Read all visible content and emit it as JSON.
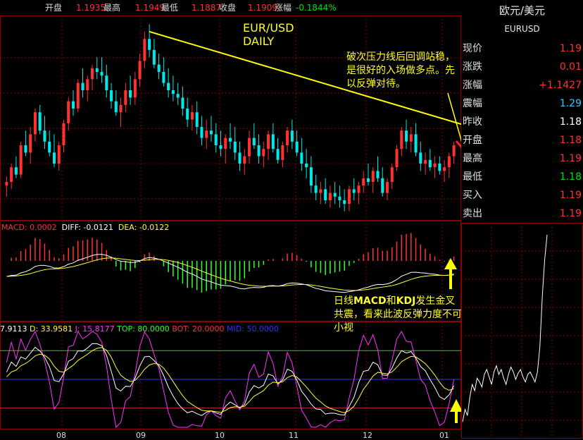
{
  "header": {
    "open_label": "开盘",
    "open_value": "1.1935",
    "high_label": "最高",
    "high_value": "1.1949",
    "low_label": "最低",
    "low_value": "1.1887",
    "close_label": "收盘",
    "close_value": "1.1909",
    "change_label": "涨幅",
    "change_value": "-0.1844%"
  },
  "instrument": {
    "name_cn": "欧元/美元",
    "code": "EURUSD"
  },
  "stats": [
    {
      "label": "现价",
      "value": "1.19",
      "color": "#ff3232"
    },
    {
      "label": "涨跌",
      "value": "0.01",
      "color": "#ff3232"
    },
    {
      "label": "涨幅",
      "value": "+1.1427",
      "color": "#ff3232"
    },
    {
      "label": "震幅",
      "value": "1.29",
      "color": "#32c8ff"
    },
    {
      "label": "昨收",
      "value": "1.18",
      "color": "#ffffff"
    },
    {
      "label": "开盘",
      "value": "1.18",
      "color": "#ff3232"
    },
    {
      "label": "最高",
      "value": "1.19",
      "color": "#ff3232"
    },
    {
      "label": "最低",
      "value": "1.18",
      "color": "#00e000"
    },
    {
      "label": "买入",
      "value": "1.19",
      "color": "#ff3232"
    },
    {
      "label": "卖出",
      "value": "1.19",
      "color": "#ff3232"
    }
  ],
  "annotations": {
    "chart_title_line1": "EUR/USD",
    "chart_title_line2": "DAILY",
    "resistance_note": "破次压力线后回调站稳，是很好的入场做多点。先以反弹对待。",
    "indicator_note_prefix": "日线",
    "indicator_note_macd": "MACD",
    "indicator_note_and": "和",
    "indicator_note_kdj": "KDJ",
    "indicator_note_suffix": "发生金叉共震，看来此波反弹力度不可小视"
  },
  "macd_label": {
    "macd": "MACD: 0.0002",
    "diff": "DIFF: -0.0121",
    "dea": "DEA: -0.0122"
  },
  "kdj_label": {
    "k": "7.9113",
    "d": "D: 33.9581",
    "j": "J: 15.8177",
    "top": "TOP: 80.0000",
    "bot": "BOT: 20.0000",
    "mid": "MID: 50.0000"
  },
  "colors": {
    "up": "#ff3232",
    "down": "#00e8e8",
    "trendline": "#ffff00",
    "grid": "#8b0000"
  },
  "chart_data": {
    "type": "candlestick",
    "title": "EUR/USD DAILY",
    "x_ticks": [
      "08",
      "09",
      "10",
      "11",
      "12",
      "01"
    ],
    "y_range": [
      1.155,
      1.21
    ],
    "candles": [
      [
        1.164,
        1.1665,
        1.161,
        1.165
      ],
      [
        1.165,
        1.17,
        1.163,
        1.169
      ],
      [
        1.169,
        1.172,
        1.166,
        1.167
      ],
      [
        1.167,
        1.176,
        1.166,
        1.175
      ],
      [
        1.175,
        1.179,
        1.172,
        1.173
      ],
      [
        1.173,
        1.18,
        1.17,
        1.178
      ],
      [
        1.178,
        1.185,
        1.176,
        1.184
      ],
      [
        1.184,
        1.186,
        1.178,
        1.179
      ],
      [
        1.179,
        1.183,
        1.174,
        1.176
      ],
      [
        1.176,
        1.179,
        1.172,
        1.173
      ],
      [
        1.173,
        1.178,
        1.169,
        1.17
      ],
      [
        1.17,
        1.176,
        1.168,
        1.175
      ],
      [
        1.175,
        1.182,
        1.173,
        1.181
      ],
      [
        1.181,
        1.188,
        1.179,
        1.187
      ],
      [
        1.187,
        1.19,
        1.183,
        1.185
      ],
      [
        1.185,
        1.193,
        1.184,
        1.192
      ],
      [
        1.192,
        1.196,
        1.188,
        1.19
      ],
      [
        1.19,
        1.194,
        1.187,
        1.193
      ],
      [
        1.193,
        1.197,
        1.19,
        1.196
      ],
      [
        1.196,
        1.199,
        1.193,
        1.195
      ],
      [
        1.195,
        1.199,
        1.192,
        1.194
      ],
      [
        1.194,
        1.197,
        1.188,
        1.19
      ],
      [
        1.19,
        1.192,
        1.185,
        1.187
      ],
      [
        1.187,
        1.19,
        1.183,
        1.184
      ],
      [
        1.184,
        1.188,
        1.18,
        1.186
      ],
      [
        1.186,
        1.192,
        1.184,
        1.19
      ],
      [
        1.19,
        1.194,
        1.186,
        1.188
      ],
      [
        1.188,
        1.195,
        1.186,
        1.193
      ],
      [
        1.193,
        1.2,
        1.191,
        1.198
      ],
      [
        1.198,
        1.206,
        1.196,
        1.204
      ],
      [
        1.204,
        1.208,
        1.199,
        1.201
      ],
      [
        1.201,
        1.204,
        1.196,
        1.197
      ],
      [
        1.197,
        1.2,
        1.193,
        1.195
      ],
      [
        1.195,
        1.199,
        1.191,
        1.192
      ],
      [
        1.192,
        1.196,
        1.188,
        1.19
      ],
      [
        1.19,
        1.194,
        1.187,
        1.189
      ],
      [
        1.189,
        1.192,
        1.186,
        1.188
      ],
      [
        1.188,
        1.191,
        1.183,
        1.185
      ],
      [
        1.185,
        1.188,
        1.18,
        1.182
      ],
      [
        1.182,
        1.186,
        1.179,
        1.184
      ],
      [
        1.184,
        1.187,
        1.178,
        1.18
      ],
      [
        1.18,
        1.183,
        1.175,
        1.177
      ],
      [
        1.177,
        1.182,
        1.174,
        1.179
      ],
      [
        1.179,
        1.183,
        1.176,
        1.178
      ],
      [
        1.178,
        1.181,
        1.173,
        1.175
      ],
      [
        1.175,
        1.179,
        1.172,
        1.174
      ],
      [
        1.174,
        1.178,
        1.17,
        1.177
      ],
      [
        1.177,
        1.181,
        1.174,
        1.176
      ],
      [
        1.176,
        1.18,
        1.171,
        1.173
      ],
      [
        1.173,
        1.176,
        1.168,
        1.17
      ],
      [
        1.17,
        1.174,
        1.167,
        1.172
      ],
      [
        1.172,
        1.179,
        1.17,
        1.177
      ],
      [
        1.177,
        1.181,
        1.174,
        1.175
      ],
      [
        1.175,
        1.178,
        1.17,
        1.172
      ],
      [
        1.172,
        1.176,
        1.169,
        1.174
      ],
      [
        1.174,
        1.179,
        1.171,
        1.178
      ],
      [
        1.178,
        1.181,
        1.173,
        1.174
      ],
      [
        1.174,
        1.177,
        1.17,
        1.171
      ],
      [
        1.171,
        1.176,
        1.169,
        1.175
      ],
      [
        1.175,
        1.18,
        1.173,
        1.179
      ],
      [
        1.179,
        1.182,
        1.174,
        1.176
      ],
      [
        1.176,
        1.179,
        1.172,
        1.173
      ],
      [
        1.173,
        1.177,
        1.168,
        1.17
      ],
      [
        1.17,
        1.174,
        1.166,
        1.169
      ],
      [
        1.169,
        1.172,
        1.162,
        1.164
      ],
      [
        1.164,
        1.167,
        1.16,
        1.162
      ],
      [
        1.162,
        1.165,
        1.159,
        1.163
      ],
      [
        1.163,
        1.166,
        1.159,
        1.16
      ],
      [
        1.16,
        1.164,
        1.158,
        1.162
      ],
      [
        1.162,
        1.165,
        1.159,
        1.161
      ],
      [
        1.161,
        1.164,
        1.158,
        1.16
      ],
      [
        1.16,
        1.163,
        1.157,
        1.159
      ],
      [
        1.159,
        1.164,
        1.157,
        1.163
      ],
      [
        1.163,
        1.166,
        1.16,
        1.162
      ],
      [
        1.162,
        1.165,
        1.159,
        1.164
      ],
      [
        1.164,
        1.168,
        1.162,
        1.166
      ],
      [
        1.166,
        1.17,
        1.164,
        1.165
      ],
      [
        1.165,
        1.169,
        1.162,
        1.168
      ],
      [
        1.168,
        1.172,
        1.165,
        1.166
      ],
      [
        1.166,
        1.169,
        1.161,
        1.162
      ],
      [
        1.162,
        1.166,
        1.16,
        1.165
      ],
      [
        1.165,
        1.17,
        1.163,
        1.169
      ],
      [
        1.169,
        1.175,
        1.168,
        1.174
      ],
      [
        1.174,
        1.18,
        1.172,
        1.179
      ],
      [
        1.179,
        1.182,
        1.174,
        1.176
      ],
      [
        1.176,
        1.18,
        1.173,
        1.178
      ],
      [
        1.178,
        1.181,
        1.172,
        1.173
      ],
      [
        1.173,
        1.176,
        1.168,
        1.17
      ],
      [
        1.17,
        1.173,
        1.167,
        1.171
      ],
      [
        1.171,
        1.174,
        1.168,
        1.169
      ],
      [
        1.169,
        1.172,
        1.166,
        1.17
      ],
      [
        1.17,
        1.172,
        1.167,
        1.168
      ],
      [
        1.168,
        1.171,
        1.165,
        1.169
      ],
      [
        1.169,
        1.173,
        1.166,
        1.172
      ],
      [
        1.172,
        1.176,
        1.17,
        1.175
      ]
    ],
    "trendline": [
      [
        1.206,
        0
      ],
      [
        1.1775,
        1
      ]
    ]
  },
  "intraday": [
    1.178,
    1.179,
    1.1785,
    1.18,
    1.181,
    1.1805,
    1.1815,
    1.1812,
    1.1808,
    1.1818,
    1.1822,
    1.1816,
    1.181,
    1.182,
    1.1825,
    1.1818,
    1.1822,
    1.1815,
    1.181,
    1.1818,
    1.1824,
    1.182,
    1.1814,
    1.1819,
    1.1822,
    1.1816,
    1.1812,
    1.1818,
    1.182,
    1.1816,
    1.1812,
    1.182,
    1.184,
    1.188,
    1.191,
    1.193
  ]
}
